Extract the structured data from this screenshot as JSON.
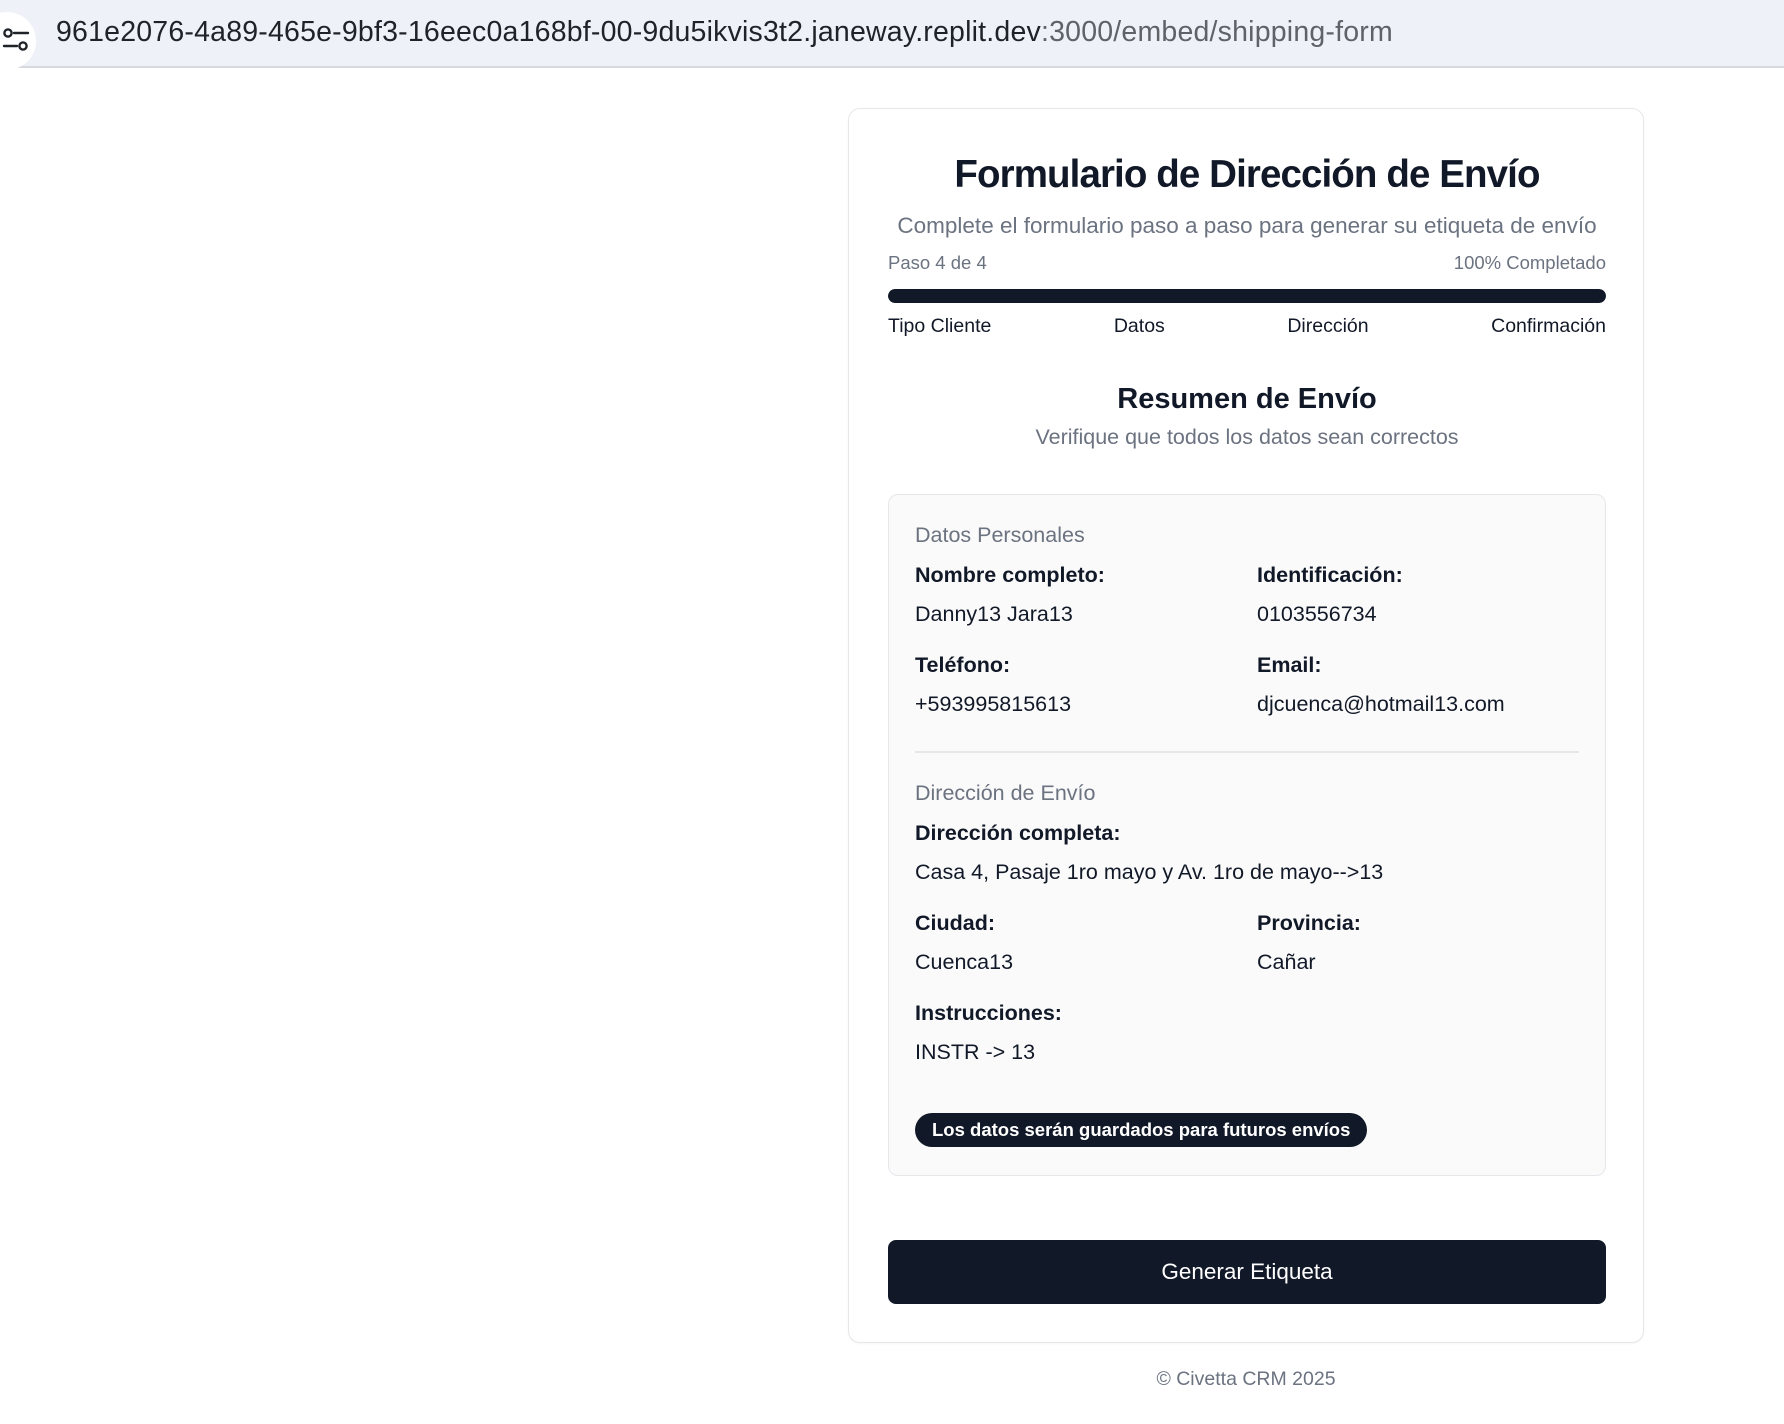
{
  "browser": {
    "url_host": "961e2076-4a89-465e-9bf3-16eec0a168bf-00-9du5ikvis3t2.janeway.replit.dev",
    "url_path": ":3000/embed/shipping-form",
    "site_icon": "tune-icon"
  },
  "form": {
    "title": "Formulario de Dirección de Envío",
    "subtitle": "Complete el formulario paso a paso para generar su etiqueta de envío",
    "progress": {
      "step_text": "Paso 4 de 4",
      "percent_text": "100% Completado",
      "fraction": 1.0
    },
    "steps": [
      "Tipo Cliente",
      "Datos",
      "Dirección",
      "Confirmación"
    ],
    "summary": {
      "title": "Resumen de Envío",
      "subtitle": "Verifique que todos los datos sean correctos",
      "personal": {
        "heading": "Datos Personales",
        "name_label": "Nombre completo:",
        "name_value": "Danny13 Jara13",
        "id_label": "Identificación:",
        "id_value": "0103556734",
        "phone_label": "Teléfono:",
        "phone_value": "+593995815613",
        "email_label": "Email:",
        "email_value": "djcuenca@hotmail13.com"
      },
      "address": {
        "heading": "Dirección de Envío",
        "full_label": "Dirección completa:",
        "full_value": "Casa 4, Pasaje 1ro mayo y Av. 1ro de mayo-->13",
        "city_label": "Ciudad:",
        "city_value": "Cuenca13",
        "province_label": "Provincia:",
        "province_value": "Cañar",
        "instructions_label": "Instrucciones:",
        "instructions_value": "INSTR -> 13"
      },
      "save_notice": "Los datos serán guardados para futuros envíos"
    },
    "generate_label": "Generar Etiqueta"
  },
  "footer": "© Civetta CRM 2025",
  "colors": {
    "primary": "#111827",
    "muted_text": "#6b7280",
    "address_bar": "#eef2f8"
  }
}
